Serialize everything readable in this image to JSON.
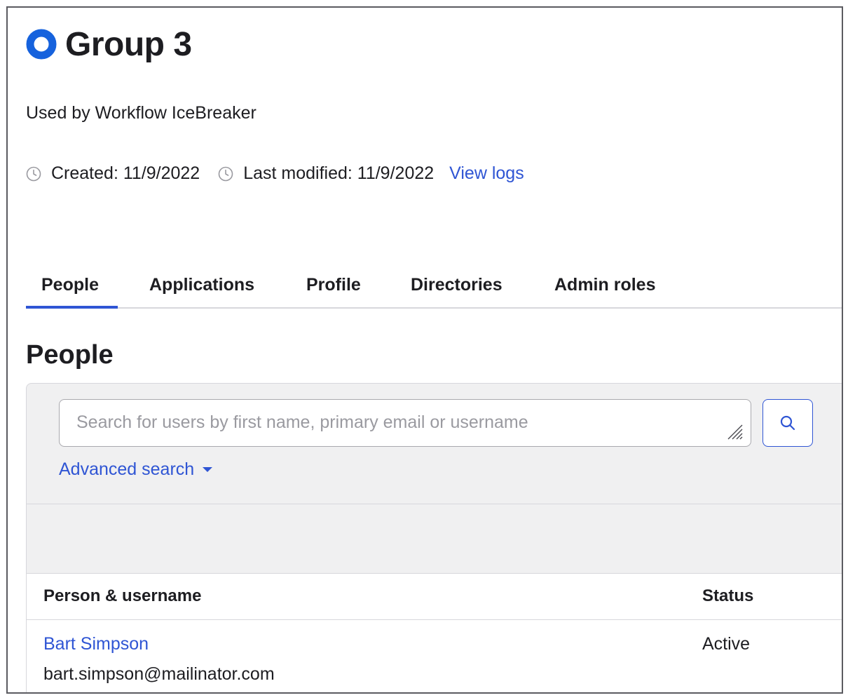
{
  "header": {
    "title": "Group 3",
    "description": "Used by Workflow IceBreaker",
    "created": "Created: 11/9/2022",
    "last_modified": "Last modified: 11/9/2022",
    "view_logs": "View logs"
  },
  "tabs": [
    {
      "label": "People",
      "active": true
    },
    {
      "label": "Applications",
      "active": false
    },
    {
      "label": "Profile",
      "active": false
    },
    {
      "label": "Directories",
      "active": false
    },
    {
      "label": "Admin roles",
      "active": false
    }
  ],
  "section_title": "People",
  "search": {
    "placeholder": "Search for users by first name, primary email or username",
    "advanced_label": "Advanced search"
  },
  "table": {
    "columns": [
      "Person & username",
      "Status"
    ],
    "rows": [
      {
        "name": "Bart Simpson",
        "email": "bart.simpson@mailinator.com",
        "status": "Active"
      }
    ]
  },
  "colors": {
    "accent": "#2f55d4",
    "group_icon": "#1662dd",
    "panel_bg": "#f0f0f1"
  },
  "icons": [
    "group-icon",
    "clock-icon",
    "search-icon",
    "resize-grip-icon",
    "caret-down-icon"
  ]
}
